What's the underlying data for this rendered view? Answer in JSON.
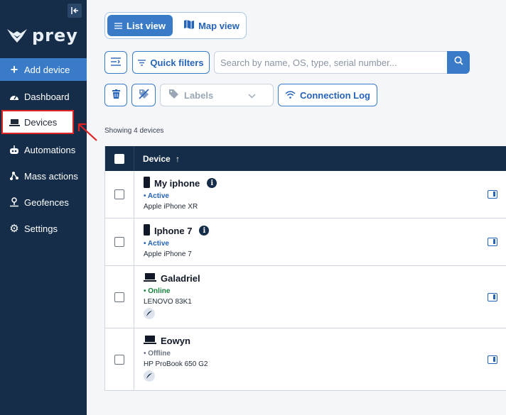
{
  "sidebar": {
    "logo_text": "prey",
    "add_device_label": "Add device",
    "items": [
      {
        "label": "Dashboard",
        "icon": "gauge-icon"
      },
      {
        "label": "Devices",
        "icon": "laptop-icon"
      },
      {
        "label": "Automations",
        "icon": "robot-icon"
      },
      {
        "label": "Mass actions",
        "icon": "nodes-icon"
      },
      {
        "label": "Geofences",
        "icon": "map-pin-icon"
      },
      {
        "label": "Settings",
        "icon": "gear-icon"
      }
    ]
  },
  "toolbar": {
    "list_view_label": "List view",
    "map_view_label": "Map view",
    "quick_filters_label": "Quick filters",
    "search_placeholder": "Search by name, OS, type, serial number...",
    "labels_label": "Labels",
    "connection_log_label": "Connection Log"
  },
  "table": {
    "showing_text": "Showing 4 devices",
    "header_device": "Device",
    "sort_indicator": "↑",
    "rows": [
      {
        "name": "My iphone",
        "status": "Active",
        "model": "Apple iPhone XR",
        "type": "phone"
      },
      {
        "name": "Iphone 7",
        "status": "Active",
        "model": "Apple iPhone 7",
        "type": "phone"
      },
      {
        "name": "Galadriel",
        "status": "Online",
        "model": "LENOVO 83K1",
        "type": "laptop"
      },
      {
        "name": "Eowyn",
        "status": "Offline",
        "model": "HP ProBook 650 G2",
        "type": "laptop"
      }
    ]
  },
  "colors": {
    "sidebar_bg": "#162d4a",
    "accent": "#3a7bc8",
    "online": "#15803d",
    "highlight": "#e02424"
  }
}
